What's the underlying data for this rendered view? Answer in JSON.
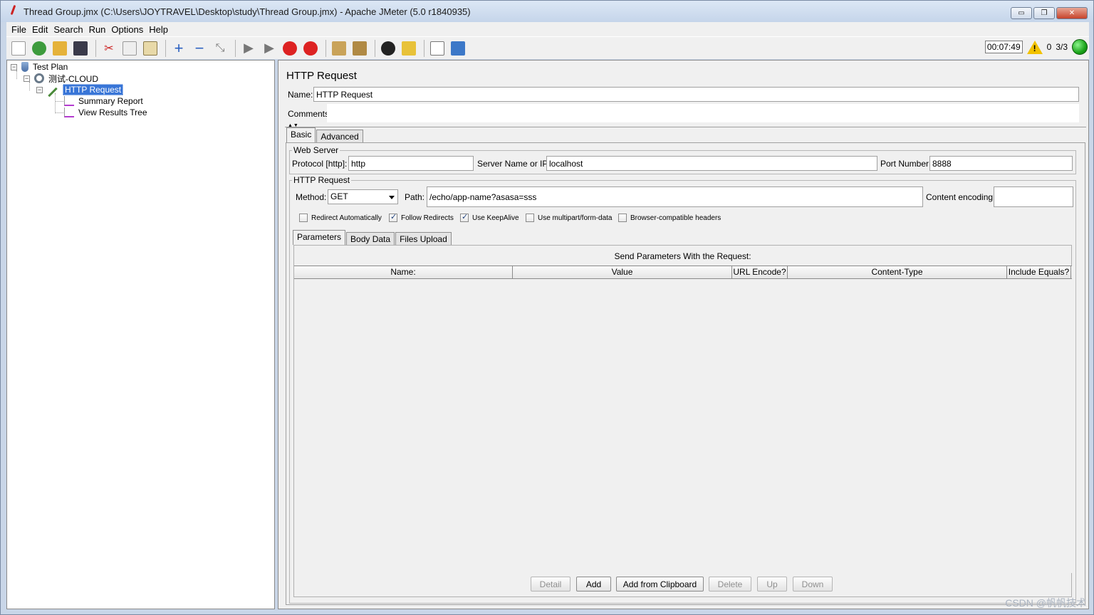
{
  "window": {
    "title": "Thread Group.jmx (C:\\Users\\JOYTRAVEL\\Desktop\\study\\Thread Group.jmx) - Apache JMeter (5.0 r1840935)",
    "minimize": "▭",
    "restore": "❐",
    "close": "✕"
  },
  "menu": {
    "items": [
      {
        "label": "File"
      },
      {
        "label": "Edit"
      },
      {
        "label": "Search"
      },
      {
        "label": "Run"
      },
      {
        "label": "Options"
      },
      {
        "label": "Help"
      }
    ]
  },
  "status": {
    "timer": "00:07:49",
    "warnings": "0",
    "threads": "3/3"
  },
  "tree": {
    "test_plan": "Test Plan",
    "thread_group": "测试-CLOUD",
    "http_request": "HTTP Request",
    "summary_report": "Summary Report",
    "view_results_tree": "View Results Tree"
  },
  "panel": {
    "title": "HTTP Request",
    "name_label": "Name:",
    "name_value": "HTTP Request",
    "comments_label": "Comments:",
    "tabs": {
      "basic": "Basic",
      "advanced": "Advanced"
    },
    "web_server": {
      "legend": "Web Server",
      "protocol_label": "Protocol [http]:",
      "protocol_value": "http",
      "server_label": "Server Name or IP:",
      "server_value": "localhost",
      "port_label": "Port Number:",
      "port_value": "8888"
    },
    "http_request": {
      "legend": "HTTP Request",
      "method_label": "Method:",
      "method_value": "GET",
      "path_label": "Path:",
      "path_value": "/echo/app-name?asasa=sss",
      "encoding_label": "Content encoding:",
      "encoding_value": ""
    },
    "checkboxes": {
      "redirect_auto": {
        "label": "Redirect Automatically",
        "checked": false
      },
      "follow_redirects": {
        "label": "Follow Redirects",
        "checked": true
      },
      "keepalive": {
        "label": "Use KeepAlive",
        "checked": true
      },
      "multipart": {
        "label": "Use multipart/form-data",
        "checked": false
      },
      "browser_headers": {
        "label": "Browser-compatible headers",
        "checked": false
      }
    },
    "sub_tabs": {
      "parameters": "Parameters",
      "body_data": "Body Data",
      "files_upload": "Files Upload"
    },
    "params": {
      "caption": "Send Parameters With the Request:",
      "columns": [
        "Name:",
        "Value",
        "URL Encode?",
        "Content-Type",
        "Include Equals?"
      ]
    },
    "buttons": {
      "detail": "Detail",
      "add": "Add",
      "add_clipboard": "Add from Clipboard",
      "delete": "Delete",
      "up": "Up",
      "down": "Down"
    }
  },
  "watermark": "CSDN @帆帆技术"
}
